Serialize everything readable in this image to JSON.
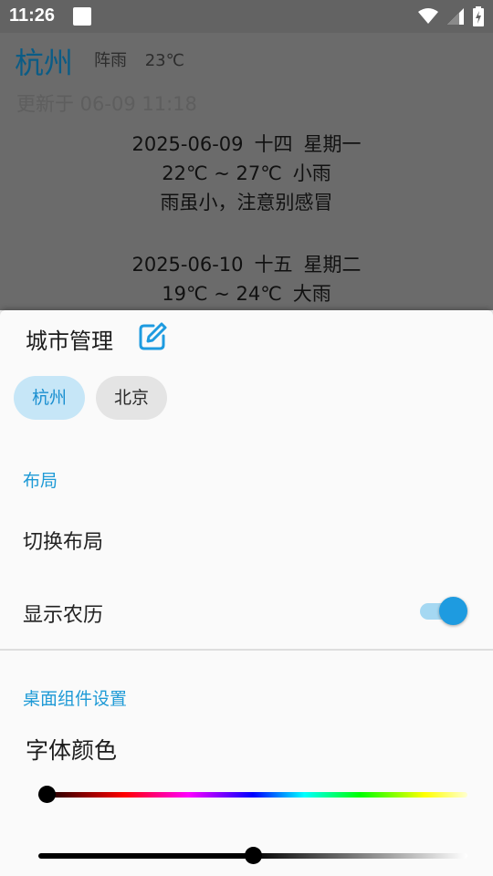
{
  "status_bar": {
    "time": "11:26",
    "icons": [
      "wifi-icon",
      "signal-icon",
      "battery-charging-icon"
    ]
  },
  "background": {
    "city": "杭州",
    "weather": "阵雨",
    "temperature": "23℃",
    "updated": "更新于 06-09 11:18",
    "forecast": [
      {
        "date": "2025-06-09",
        "lunar": "十四",
        "weekday": "星期一",
        "range": "22℃ ~ 27℃",
        "condition": "小雨",
        "tip": "雨虽小，注意别感冒"
      },
      {
        "date": "2025-06-10",
        "lunar": "十五",
        "weekday": "星期二",
        "range": "19℃ ~ 24℃",
        "condition": "大雨"
      }
    ]
  },
  "sheet": {
    "city_manage_title": "城市管理",
    "cities": [
      "杭州",
      "北京"
    ],
    "selected_city": "杭州",
    "layout_section": "布局",
    "switch_layout": "切换布局",
    "show_lunar": "显示农历",
    "show_lunar_on": true,
    "widget_section": "桌面组件设置",
    "font_color_title": "字体颜色",
    "hue_slider_value": 0.02,
    "brightness_slider_value": 0.5
  },
  "colors": {
    "accent": "#1e9ad6",
    "chip_selected_bg": "#c6e6f7",
    "chip_bg": "#e4e4e4",
    "scrim": "#6b6b6b"
  }
}
